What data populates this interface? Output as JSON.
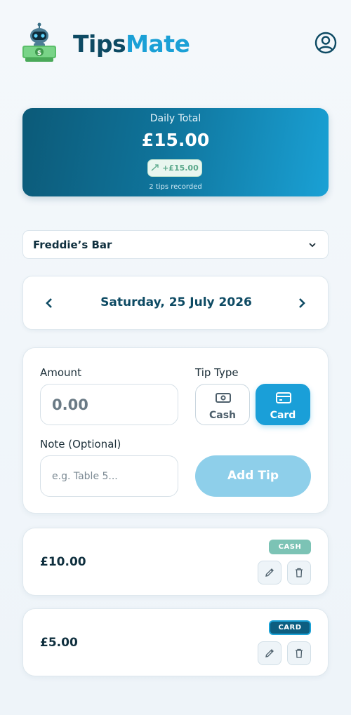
{
  "header": {
    "brand_part1": "Tips",
    "brand_part2": "Mate",
    "logo_icon": "robot-money-icon",
    "profile_icon": "user-circle-icon"
  },
  "summary": {
    "label": "Daily Total",
    "total": "£15.00",
    "change": "+£15.00",
    "change_icon": "trend-up-icon",
    "count_text": "2 tips recorded"
  },
  "venue": {
    "selected": "Freddie’s Bar"
  },
  "date_nav": {
    "date": "Saturday, 25 July 2026"
  },
  "form": {
    "amount_label": "Amount",
    "amount_placeholder": "0.00",
    "type_label": "Tip Type",
    "cash_label": "Cash",
    "card_label": "Card",
    "selected_type": "Card",
    "note_label": "Note (Optional)",
    "note_placeholder": "e.g. Table 5...",
    "add_label": "Add Tip"
  },
  "tips": [
    {
      "amount": "£10.00",
      "type": "CASH"
    },
    {
      "amount": "£5.00",
      "type": "CARD"
    }
  ],
  "colors": {
    "primary": "#0d4a63",
    "accent": "#1ba0d6",
    "cash_badge": "#7cc3b5",
    "card_badge": "#0d5e80",
    "add_button": "#8ecfea"
  }
}
